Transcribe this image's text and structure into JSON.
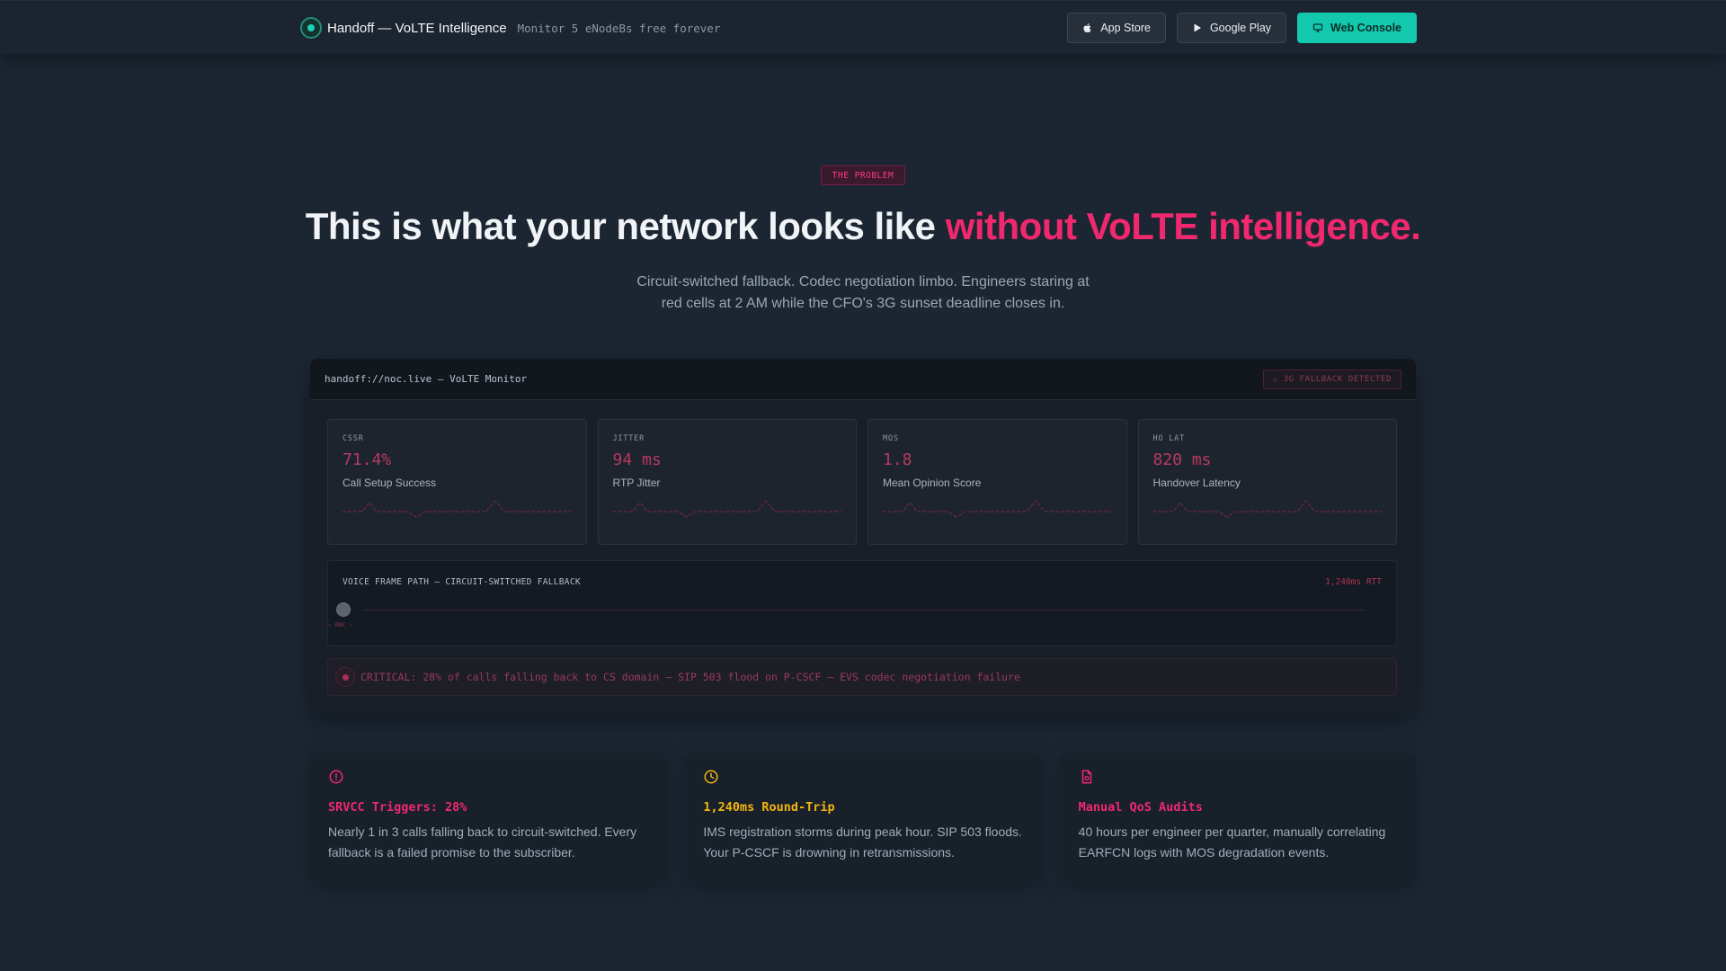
{
  "nav": {
    "brand": "Handoff — VoLTE Intelligence",
    "tagline": "Monitor 5 eNodeBs free forever",
    "buttons": {
      "app_store": "App Store",
      "google_play": "Google Play",
      "web_console": "Web Console"
    }
  },
  "hero": {
    "badge": "THE PROBLEM",
    "headline_main": "This is what your network looks like ",
    "headline_accent": "without VoLTE intelligence.",
    "subtitle": "Circuit-switched fallback. Codec negotiation limbo. Engineers staring at red cells at 2 AM while the CFO's 3G sunset deadline closes in."
  },
  "monitor": {
    "title": "handoff://noc.live — VoLTE Monitor",
    "status_tag": "⚠ 3G FALLBACK DETECTED",
    "metrics": [
      {
        "label": "CSSR",
        "value": "71.4%",
        "desc": "Call Setup Success"
      },
      {
        "label": "JITTER",
        "value": "94 ms",
        "desc": "RTP Jitter"
      },
      {
        "label": "MOS",
        "value": "1.8",
        "desc": "Mean Opinion Score"
      },
      {
        "label": "HO LAT",
        "value": "820 ms",
        "desc": "Handover Latency"
      }
    ],
    "path": {
      "title": "VOICE FRAME PATH — CIRCUIT-SWITCHED FALLBACK",
      "rtt": "1,240ms RTT",
      "node_label": "⚠ RNC ⚠"
    },
    "alert": "CRITICAL: 28% of calls falling back to CS domain — SIP 503 flood on P-CSCF — EVS codec negotiation failure"
  },
  "cards": [
    {
      "icon": "alert-circle-icon",
      "color": "#f0286e",
      "title": "SRVCC Triggers: 28%",
      "body": "Nearly 1 in 3 calls falling back to circuit-switched. Every fallback is a failed promise to the subscriber."
    },
    {
      "icon": "clock-icon",
      "color": "#f5b50f",
      "title": "1,240ms Round-Trip",
      "body": "IMS registration storms during peak hour. SIP 503 floods. Your P-CSCF is drowning in retransmissions."
    },
    {
      "icon": "document-icon",
      "color": "#f0286e",
      "title": "Manual QoS Audits",
      "body": "40 hours per engineer per quarter, manually correlating EARFCN logs with MOS degradation events."
    }
  ],
  "colors": {
    "background": "#1c2632",
    "accent_teal": "#12c9ad",
    "accent_pink": "#f0286e",
    "accent_amber": "#f5b50f"
  }
}
